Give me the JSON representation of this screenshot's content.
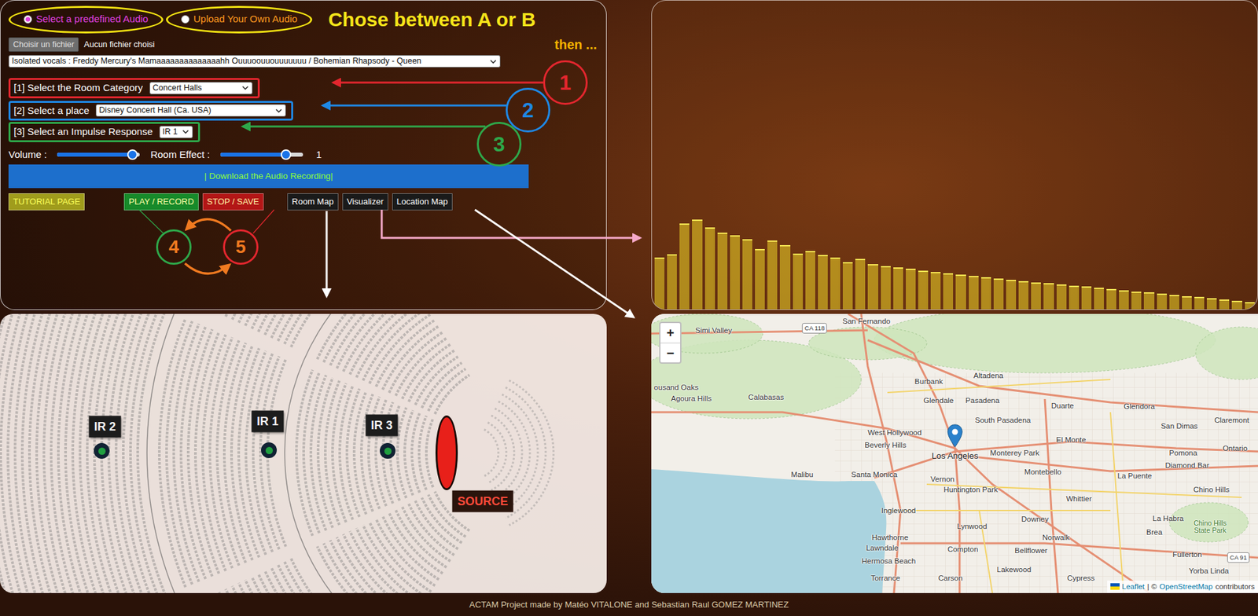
{
  "source_choice": {
    "options": [
      {
        "label": "Select a predefined Audio",
        "selected": true,
        "color": "#e040e0"
      },
      {
        "label": "Upload Your Own Audio",
        "selected": false,
        "color": "#ff9a1f"
      }
    ],
    "hint": "Chose between A or B",
    "then": "then ..."
  },
  "file_input": {
    "button": "Choisir un fichier",
    "status": "Aucun fichier choisi"
  },
  "audio_select": {
    "value": "Isolated vocals : Freddy Mercury's Mamaaaaaaaaaaaaaahh Ouuuoouuouuuuuuu / Bohemian Rhapsody - Queen"
  },
  "steps": [
    {
      "label": "[1] Select the Room Category",
      "value": "Concert Halls",
      "number": "1",
      "color": "#e3262e"
    },
    {
      "label": "[2] Select a place",
      "value": "Disney Concert Hall (Ca. USA)",
      "number": "2",
      "color": "#1e88e5"
    },
    {
      "label": "[3] Select an Impulse Response",
      "value": "IR 1",
      "number": "3",
      "color": "#2ea84a"
    }
  ],
  "volume": {
    "label": "Volume :",
    "level": 0.91
  },
  "room_effect": {
    "label": "Room Effect :",
    "level": 0.79,
    "reading": "1"
  },
  "download": {
    "label": "| Download the Audio Recording|"
  },
  "buttons": [
    {
      "label": "TUTORIAL PAGE",
      "kind": "tutorial"
    },
    {
      "label": "PLAY / RECORD",
      "kind": "play"
    },
    {
      "label": "STOP / SAVE",
      "kind": "stop"
    },
    {
      "label": "Room Map",
      "kind": "view"
    },
    {
      "label": "Visualizer",
      "kind": "view"
    },
    {
      "label": "Location Map",
      "kind": "view"
    }
  ],
  "record_steps": [
    {
      "number": "4",
      "color": "#2ea84a"
    },
    {
      "number": "5",
      "color": "#e3262e"
    }
  ],
  "visualizer": {
    "values": [
      118,
      126,
      196,
      205,
      188,
      176,
      170,
      160,
      138,
      158,
      147,
      128,
      134,
      124,
      118,
      108,
      116,
      104,
      99,
      96,
      93,
      89,
      86,
      83,
      79,
      76,
      73,
      70,
      68,
      65,
      62,
      60,
      57,
      54,
      52,
      49,
      47,
      44,
      41,
      39,
      36,
      33,
      30,
      28,
      25,
      22,
      19,
      16
    ]
  },
  "room_map": {
    "markers": [
      {
        "label": "IR 2",
        "kind": "ir"
      },
      {
        "label": "IR 1",
        "kind": "ir"
      },
      {
        "label": "IR 3",
        "kind": "ir"
      },
      {
        "label": "SOURCE",
        "kind": "source"
      }
    ]
  },
  "location_map": {
    "zoom_in": "+",
    "zoom_out": "−",
    "attribution": {
      "leaflet": "Leaflet",
      "separator": "| ©",
      "osm": "OpenStreetMap",
      "tail": "contributors"
    },
    "places": [
      {
        "name": "Simi Valley",
        "kind": "town"
      },
      {
        "name": "San Fernando",
        "kind": "town"
      },
      {
        "name": "CA 118",
        "kind": "road"
      },
      {
        "name": "Burbank",
        "kind": "town"
      },
      {
        "name": "Altadena",
        "kind": "town"
      },
      {
        "name": "Glendale",
        "kind": "town"
      },
      {
        "name": "Pasadena",
        "kind": "town"
      },
      {
        "name": "Glendora",
        "kind": "town"
      },
      {
        "name": "ousand Oaks",
        "kind": "town"
      },
      {
        "name": "Agoura Hills",
        "kind": "town"
      },
      {
        "name": "Calabasas",
        "kind": "town"
      },
      {
        "name": "West Hollywood",
        "kind": "town"
      },
      {
        "name": "Beverly Hills",
        "kind": "town"
      },
      {
        "name": "Los Angeles",
        "kind": "major"
      },
      {
        "name": "South Pasadena",
        "kind": "town"
      },
      {
        "name": "El Monte",
        "kind": "town"
      },
      {
        "name": "Monterey Park",
        "kind": "town"
      },
      {
        "name": "Montebello",
        "kind": "town"
      },
      {
        "name": "Duarte",
        "kind": "town"
      },
      {
        "name": "San Dimas",
        "kind": "town"
      },
      {
        "name": "Claremont",
        "kind": "town"
      },
      {
        "name": "Pomona",
        "kind": "town"
      },
      {
        "name": "Ontario",
        "kind": "town"
      },
      {
        "name": "Diamond Bar",
        "kind": "town"
      },
      {
        "name": "La Puente",
        "kind": "town"
      },
      {
        "name": "Malibu",
        "kind": "town"
      },
      {
        "name": "Santa Monica",
        "kind": "town"
      },
      {
        "name": "Vernon",
        "kind": "town"
      },
      {
        "name": "Huntington Park",
        "kind": "town"
      },
      {
        "name": "Whittier",
        "kind": "town"
      },
      {
        "name": "Chino Hills",
        "kind": "town"
      },
      {
        "name": "Inglewood",
        "kind": "town"
      },
      {
        "name": "Downey",
        "kind": "town"
      },
      {
        "name": "La Habra",
        "kind": "town"
      },
      {
        "name": "Brea",
        "kind": "town"
      },
      {
        "name": "Chino Hills State Park",
        "kind": "park"
      },
      {
        "name": "Lynwood",
        "kind": "town"
      },
      {
        "name": "Hawthorne",
        "kind": "town"
      },
      {
        "name": "Norwalk",
        "kind": "town"
      },
      {
        "name": "Lawndale",
        "kind": "town"
      },
      {
        "name": "Compton",
        "kind": "town"
      },
      {
        "name": "Bellflower",
        "kind": "town"
      },
      {
        "name": "Fullerton",
        "kind": "town"
      },
      {
        "name": "CA 91",
        "kind": "road"
      },
      {
        "name": "Hermosa Beach",
        "kind": "town"
      },
      {
        "name": "Lakewood",
        "kind": "town"
      },
      {
        "name": "Yorba Linda",
        "kind": "town"
      },
      {
        "name": "Torrance",
        "kind": "town"
      },
      {
        "name": "Carson",
        "kind": "town"
      },
      {
        "name": "Cypress",
        "kind": "town"
      }
    ]
  },
  "footer": "ACTAM Project made by Matéo VITALONE and Sebastian Raul GOMEZ MARTINEZ"
}
